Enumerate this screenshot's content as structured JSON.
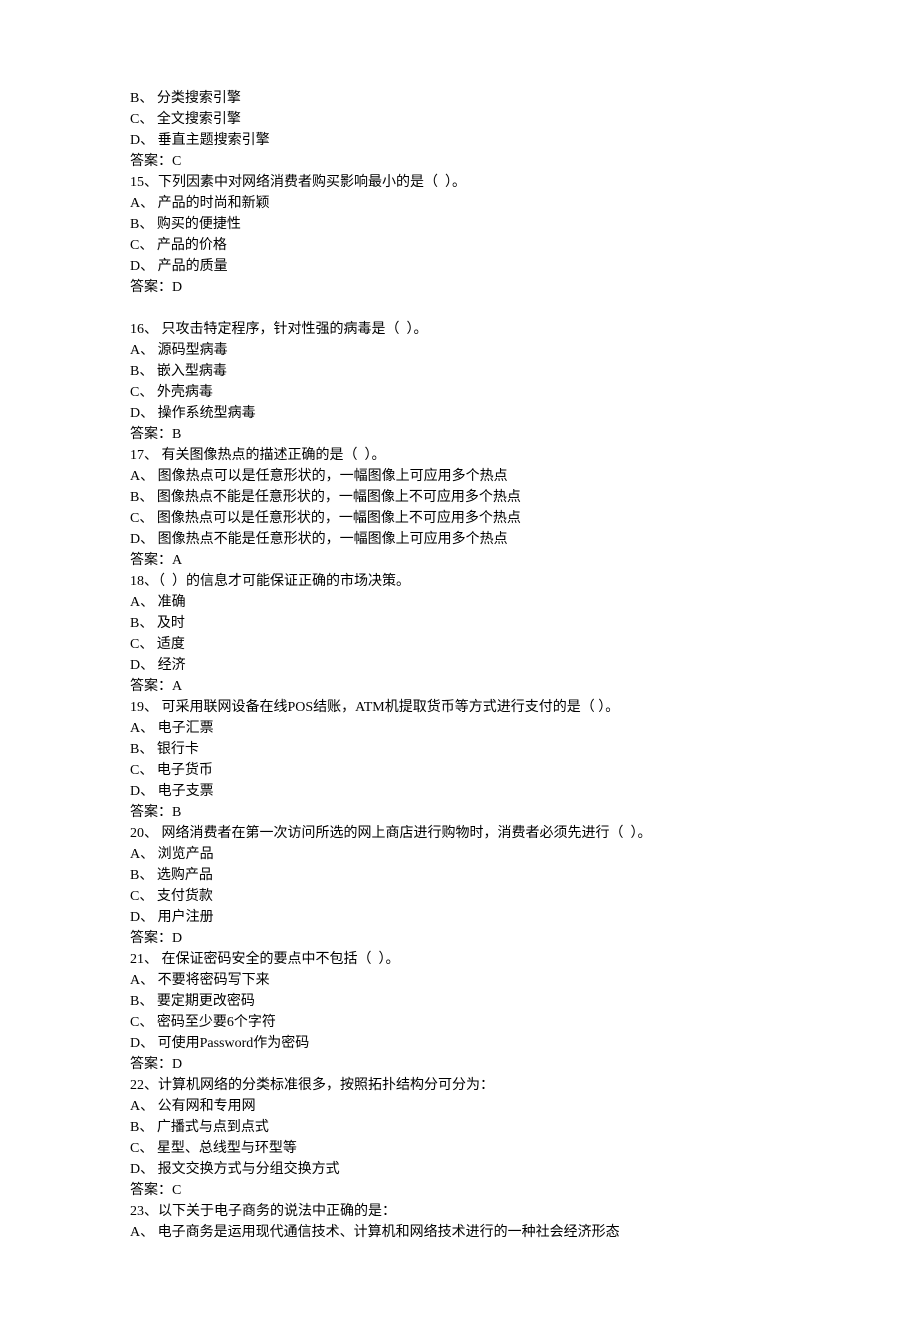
{
  "lines": [
    "B、 分类搜索引擎",
    "C、 全文搜索引擎",
    "D、 垂直主题搜索引擎",
    "答案：C",
    "15、下列因素中对网络消费者购买影响最小的是（  ）。",
    "A、 产品的时尚和新颖",
    "B、 购买的便捷性",
    "C、 产品的价格",
    "D、 产品的质量",
    "答案：D",
    "",
    "16、 只攻击特定程序，针对性强的病毒是（  ）。",
    "A、 源码型病毒",
    "B、 嵌入型病毒",
    "C、 外壳病毒",
    "D、 操作系统型病毒",
    "答案：B",
    "17、 有关图像热点的描述正确的是（  ）。",
    "A、 图像热点可以是任意形状的，一幅图像上可应用多个热点",
    "B、 图像热点不能是任意形状的，一幅图像上不可应用多个热点",
    "C、 图像热点可以是任意形状的，一幅图像上不可应用多个热点",
    "D、 图像热点不能是任意形状的，一幅图像上可应用多个热点",
    "答案：A",
    "18、（  ）的信息才可能保证正确的市场决策。",
    "A、 准确",
    "B、 及时",
    "C、 适度",
    "D、 经济",
    "答案：A",
    "19、 可采用联网设备在线POS结账，ATM机提取货币等方式进行支付的是（ ）。",
    "A、 电子汇票",
    "B、 银行卡",
    "C、 电子货币",
    "D、 电子支票",
    "答案：B",
    "20、 网络消费者在第一次访问所选的网上商店进行购物时，消费者必须先进行（  ）。",
    "A、 浏览产品",
    "B、 选购产品",
    "C、 支付货款",
    "D、 用户注册",
    "答案：D",
    "21、 在保证密码安全的要点中不包括（  ）。",
    "A、 不要将密码写下来",
    "B、 要定期更改密码",
    "C、 密码至少要6个字符",
    "D、 可使用Password作为密码",
    "答案：D",
    "22、计算机网络的分类标准很多，按照拓扑结构分可分为：",
    "A、 公有网和专用网",
    "B、 广播式与点到点式",
    "C、 星型、总线型与环型等",
    "D、 报文交换方式与分组交换方式",
    "答案：C",
    "23、以下关于电子商务的说法中正确的是：",
    "A、 电子商务是运用现代通信技术、计算机和网络技术进行的一种社会经济形态"
  ]
}
